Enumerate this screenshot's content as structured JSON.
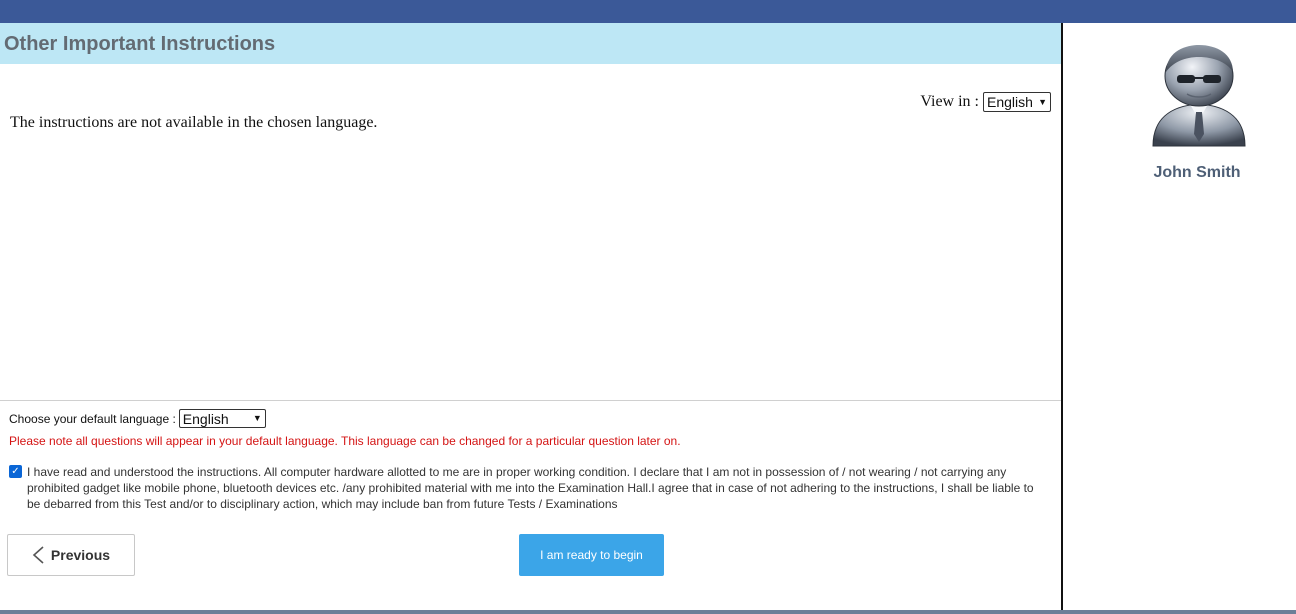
{
  "header": {
    "title": "Other Important Instructions"
  },
  "view_in": {
    "label": "View in :",
    "selected": "English"
  },
  "instructions": {
    "text": "The instructions are not available in the chosen language."
  },
  "default_language": {
    "label": "Choose your default language :",
    "selected": "English",
    "note": "Please note all questions will appear in your default language. This language can be changed for a particular question later on."
  },
  "agreement": {
    "checked": true,
    "text": "I have read and understood the instructions. All computer hardware allotted to me are in proper working condition. I declare that I am not in possession of / not wearing / not carrying any prohibited gadget like mobile phone, bluetooth devices etc. /any prohibited material with me into the Examination Hall.I agree that in case of not adhering to the instructions, I shall be liable to be debarred from this Test and/or to disciplinary action, which may include ban from future Tests / Examinations"
  },
  "buttons": {
    "previous_label": "Previous",
    "begin_label": "I am ready to begin"
  },
  "profile": {
    "name": "John Smith",
    "avatar_icon": "user-avatar-icon"
  },
  "colors": {
    "top_bar": "#3b5998",
    "header_bg": "#bde7f5",
    "begin_button": "#3ba5e8",
    "note_text": "#d41414"
  }
}
